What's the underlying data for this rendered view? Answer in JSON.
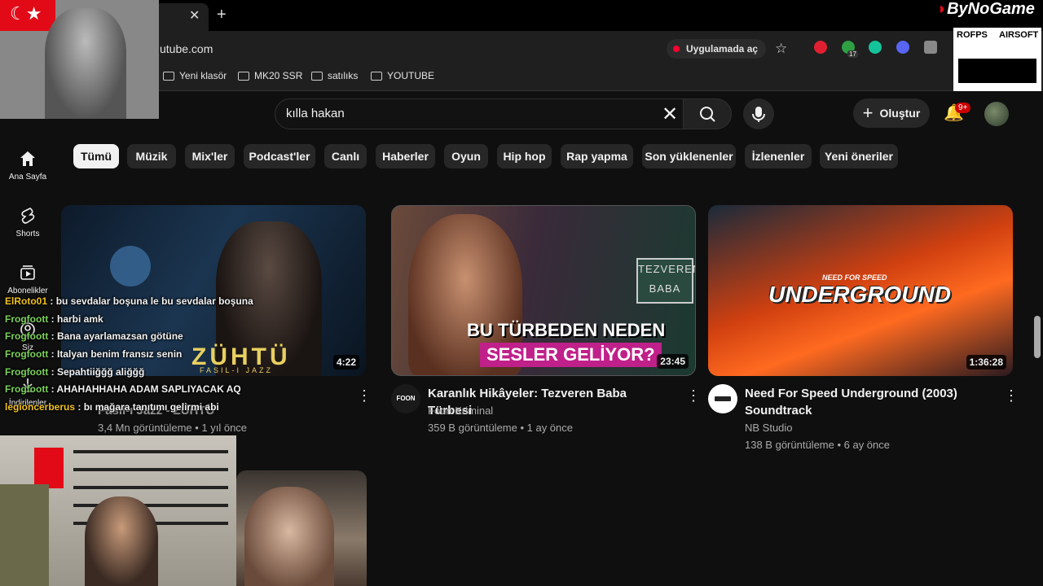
{
  "browser": {
    "url": "utube.com",
    "open_in_app": "Uygulamada aç",
    "extension_badge": "17",
    "bookmarks": [
      "Yeni klasör",
      "MK20 SSR",
      "satılıks",
      "YOUTUBE"
    ]
  },
  "header": {
    "search_value": "kılla hakan",
    "create_label": "Oluştur",
    "notification_badge": "9+"
  },
  "sidebar": {
    "items": [
      {
        "label": "Ana Sayfa",
        "icon": "home-icon"
      },
      {
        "label": "Shorts",
        "icon": "shorts-icon"
      },
      {
        "label": "Abonelikler",
        "icon": "subscriptions-icon"
      },
      {
        "label": "Siz",
        "icon": "you-icon"
      },
      {
        "label": "İndirilenler",
        "icon": "download-icon"
      }
    ]
  },
  "chips": [
    "Tümü",
    "Müzik",
    "Mix'ler",
    "Podcast'ler",
    "Canlı",
    "Haberler",
    "Oyun",
    "Hip hop",
    "Rap yapma",
    "Son yüklenenler",
    "İzlenenler",
    "Yeni öneriler"
  ],
  "videos": [
    {
      "title": "Fasıl-ı Jazz - ZÜHTÜ",
      "channel": "Fasıl-ı Jazz",
      "meta": "3,4 Mn görüntüleme • 1 yıl önce",
      "duration": "4:22",
      "thumb_text": "ZÜHTÜ",
      "thumb_sub": "FASIL-I JAZZ"
    },
    {
      "title": "Karanlık Hikâyeler: Tezveren Baba Türbesi",
      "channel": "Foon Kriminal",
      "meta": "359 B görüntüleme • 1 ay önce",
      "duration": "23:45",
      "thumb_line1": "BU TÜRBEDEN NEDEN",
      "thumb_line2": "SESLER GELİYOR?",
      "thumb_sign": "TEZVEREN BABA",
      "channel_avatar_text": "FOON"
    },
    {
      "title": "Need For Speed Underground (2003) Soundtrack",
      "channel": "NB Studio",
      "meta": "138 B görüntüleme • 6 ay önce",
      "duration": "1:36:28",
      "thumb_brand": "NEED FOR SPEED",
      "thumb_logo": "UNDERGROUND"
    }
  ],
  "chat": [
    {
      "user": "ElRoto01",
      "msg": "bu sevdalar boşuna le bu sevdalar boşuna"
    },
    {
      "user": "Frogfoott",
      "msg": "harbi amk"
    },
    {
      "user": "Frogfoott",
      "msg": "Bana ayarlamazsan götüne"
    },
    {
      "user": "Frogfoott",
      "msg": "Italyan benim fransız senin"
    },
    {
      "user": "Frogfoott",
      "msg": "Sepahtiiğğğ aliğğğ"
    },
    {
      "user": "Frogfoott",
      "msg": "AHAHAHHAHA ADAM SAPLIYACAK AQ"
    },
    {
      "user": "legioncerberus",
      "msg": "bı mağara tanıtımı gelirmi abi"
    }
  ],
  "overlay": {
    "brand": "ByNoGame",
    "sponsor_left": "ROFPS",
    "sponsor_right": "AIRSOFT"
  },
  "colors": {
    "accent": "#ff0033",
    "chat_user": "#7cd15a",
    "chat_user_alt": "#f0c020"
  }
}
